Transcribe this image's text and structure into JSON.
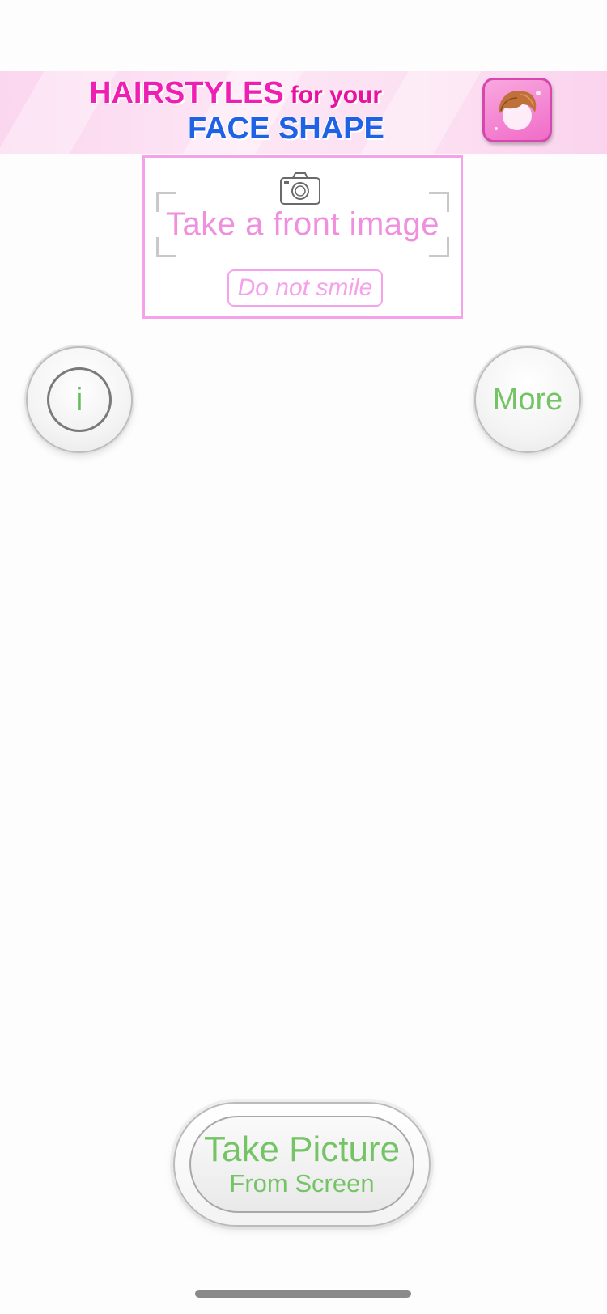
{
  "banner": {
    "line1_big": "HAIRSTYLES",
    "line1_small": "for your",
    "line2": "FACE SHAPE",
    "icon": "hair-avatar-icon"
  },
  "capture": {
    "icon": "camera-icon",
    "instruction": "Take a front image",
    "hint": "Do not smile"
  },
  "buttons": {
    "info_label": "i",
    "more_label": "More",
    "take_line1": "Take Picture",
    "take_line2": "From Screen"
  },
  "colors": {
    "accent_green": "#74c466",
    "pink_frame": "#f5a2ea",
    "pink_text": "#f08fdd",
    "banner_magenta": "#f01fb4",
    "banner_blue": "#1f62e6"
  }
}
